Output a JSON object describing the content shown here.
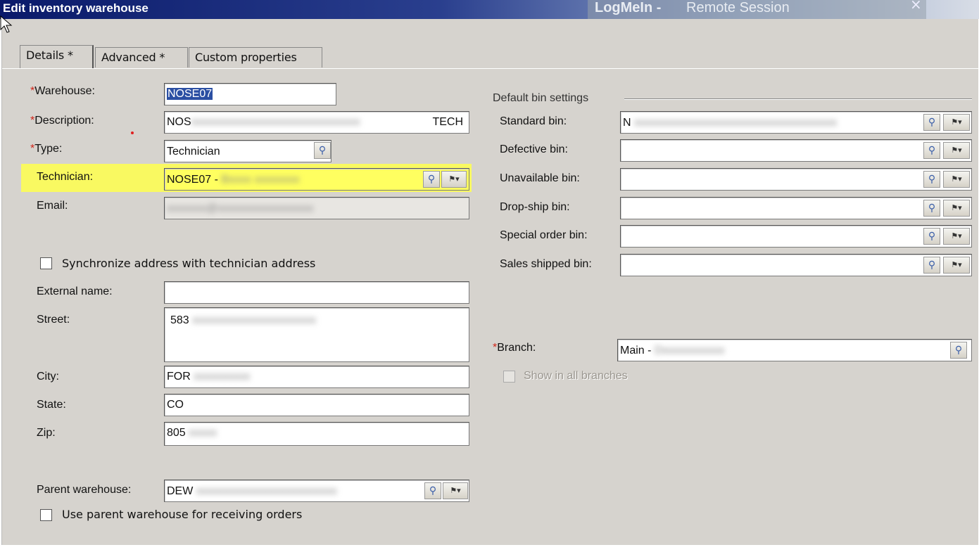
{
  "window": {
    "title": "Edit inventory warehouse",
    "overlay_brand": "LogMeIn -",
    "overlay_sub": "Remote Session",
    "overlay_close": "×"
  },
  "tabs": [
    "Details *",
    "Advanced *",
    "Custom properties"
  ],
  "left": {
    "warehouse_label": "Warehouse:",
    "warehouse_value": "NOSE07",
    "description_label": "Description:",
    "description_prefix": "NOS",
    "description_suffix": "TECH",
    "type_label": "Type:",
    "type_value": "Technician",
    "technician_label": "Technician:",
    "technician_value": "NOSE07 -",
    "email_label": "Email:",
    "sync_label": "Synchronize address with technician address",
    "external_label": "External name:",
    "external_value": "",
    "street_label": "Street:",
    "street_value": "583",
    "city_label": "City:",
    "city_value": "FOR",
    "state_label": "State:",
    "state_value": "CO",
    "zip_label": "Zip:",
    "zip_value": "805",
    "parent_label": "Parent warehouse:",
    "parent_value": "DEW",
    "use_parent_label": "Use parent warehouse for receiving orders"
  },
  "right": {
    "group_title": "Default bin settings",
    "bins": [
      {
        "label": "Standard bin:",
        "value": "N"
      },
      {
        "label": "Defective bin:",
        "value": ""
      },
      {
        "label": "Unavailable bin:",
        "value": ""
      },
      {
        "label": "Drop-ship bin:",
        "value": ""
      },
      {
        "label": "Special order bin:",
        "value": ""
      },
      {
        "label": "Sales shipped bin:",
        "value": ""
      }
    ],
    "branch_label": "Branch:",
    "branch_value": "Main -",
    "show_all_label": "Show in all branches"
  },
  "icons": {
    "lookup": "magnifier-icon",
    "dropdown": "flag-dropdown-icon"
  }
}
